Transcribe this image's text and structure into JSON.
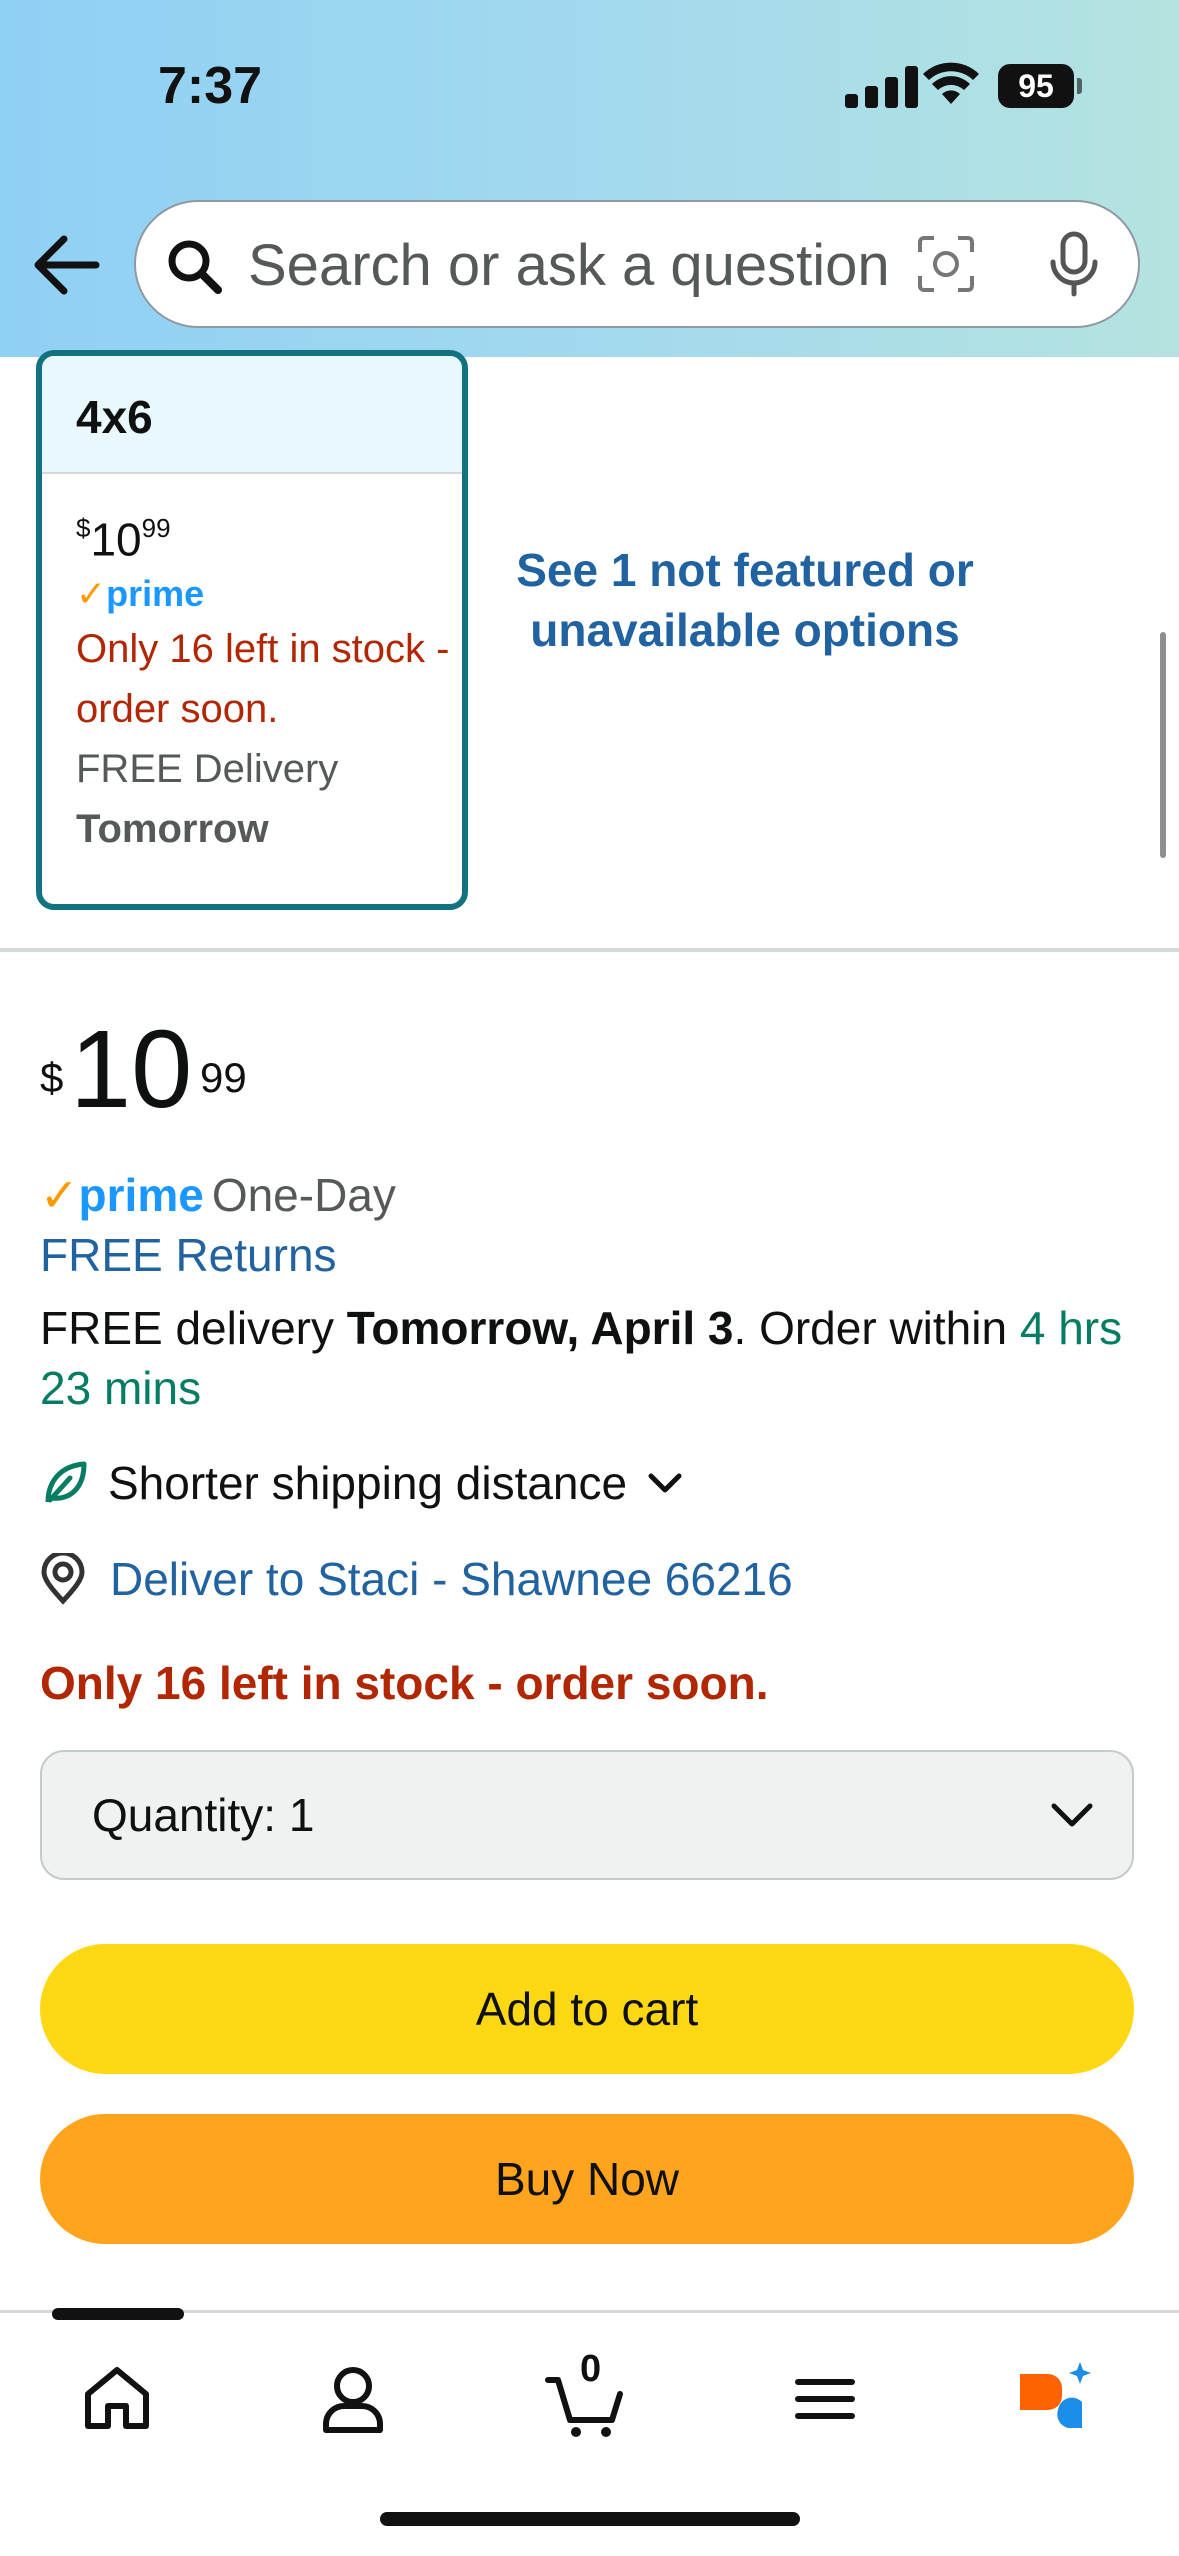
{
  "status_bar": {
    "time": "7:37",
    "battery": "95"
  },
  "header": {
    "search_placeholder": "Search or ask a question"
  },
  "variant": {
    "size_label": "4x6",
    "price_symbol": "$",
    "price_whole": "10",
    "price_fraction": "99",
    "prime_label": "prime",
    "stock_text": "Only 16 left in stock - order soon.",
    "delivery_label": "FREE Delivery",
    "delivery_date": "Tomorrow"
  },
  "see_more_options": "See 1 not featured or unavailable options",
  "buybox": {
    "price_symbol": "$",
    "price_whole": "10",
    "price_fraction": "99",
    "prime_label": "prime",
    "prime_speed": "One-Day",
    "returns": "FREE Returns",
    "delivery_prefix": "FREE delivery",
    "delivery_date": "Tomorrow, April 3",
    "order_within_prefix": ". Order within",
    "order_within_time": "4 hrs 23 mins",
    "shipping_note": "Shorter shipping distance",
    "deliver_to": "Deliver to Staci - Shawnee 66216",
    "stock_text": "Only 16 left in stock - order soon.",
    "quantity_label": "Quantity:",
    "quantity_value": "1",
    "add_to_cart": "Add to cart",
    "buy_now": "Buy Now"
  },
  "nav": {
    "items": [
      {
        "icon": "home-icon"
      },
      {
        "icon": "account-icon"
      },
      {
        "icon": "cart-icon",
        "count": "0"
      },
      {
        "icon": "menu-icon"
      },
      {
        "icon": "rufus-icon"
      }
    ]
  },
  "colors": {
    "accent_teal": "#127280",
    "link_blue": "#2162a1",
    "alert_red": "#b12704",
    "add_to_cart": "#ffd814",
    "buy_now": "#ffa41c",
    "prime_blue": "#1a98ff",
    "prime_check": "#ff9900"
  }
}
